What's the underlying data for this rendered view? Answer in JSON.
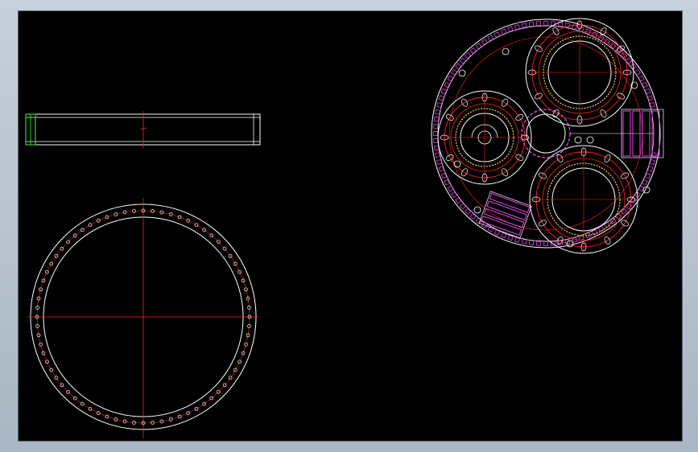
{
  "drawing": {
    "background": "#000000",
    "frame_color": "#b8c4cf",
    "colors": {
      "outline": "#ffffff",
      "centerline": "#ff2020",
      "bolts": "#ff4cff",
      "accent_green": "#2bd62b",
      "accent_yellow": "#ffd040"
    },
    "views": [
      {
        "name": "side-view",
        "kind": "bar"
      },
      {
        "name": "bearing-ring-top-view",
        "kind": "ring",
        "holes": 72
      },
      {
        "name": "planetary-gear-assembly",
        "kind": "assembly",
        "planets": 3
      }
    ]
  }
}
